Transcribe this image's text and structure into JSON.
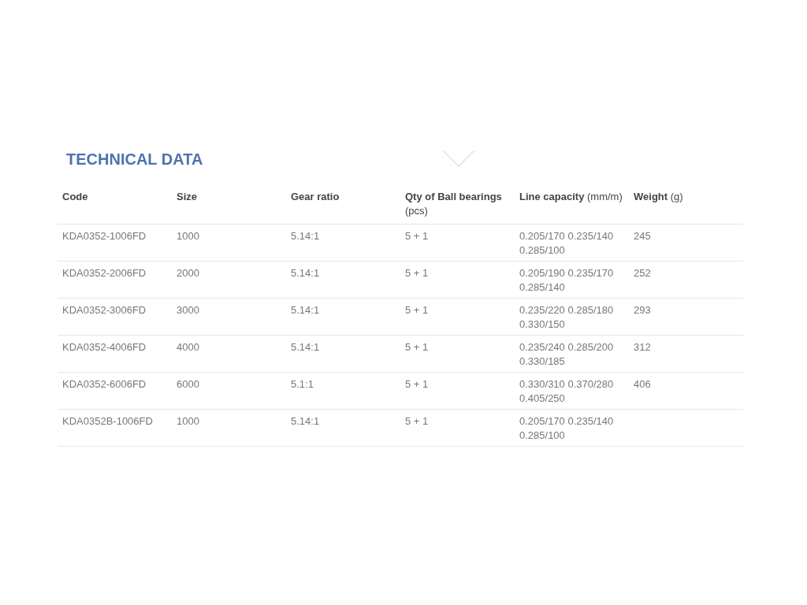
{
  "title": "TECHNICAL DATA",
  "table": {
    "columns": [
      "Code",
      "Size",
      "Gear ratio",
      "**Qty of Ball bearings** (pcs)",
      "**Line capacity** (mm/m)",
      "**Weight** (g)"
    ],
    "rows": [
      [
        "KDA0352-1006FD",
        "1000",
        "5.14:1",
        "5 + 1",
        "0.205/170 0.235/140 0.285/100",
        "245"
      ],
      [
        "KDA0352-2006FD",
        "2000",
        "5.14:1",
        "5 + 1",
        "0.205/190 0.235/170 0.285/140",
        "252"
      ],
      [
        "KDA0352-3006FD",
        "3000",
        "5.14:1",
        "5 + 1",
        "0.235/220 0.285/180 0.330/150",
        "293"
      ],
      [
        "KDA0352-4006FD",
        "4000",
        "5.14:1",
        "5 + 1",
        "0.235/240 0.285/200 0.330/185",
        "312"
      ],
      [
        "KDA0352-6006FD",
        "6000",
        "5.1:1",
        "5 + 1",
        "0.330/310 0.370/280 0.405/250",
        "406"
      ],
      [
        "KDA0352B-1006FD",
        "1000",
        "5.14:1",
        "5 + 1",
        "0.205/170 0.235/140 0.285/100",
        ""
      ]
    ]
  }
}
